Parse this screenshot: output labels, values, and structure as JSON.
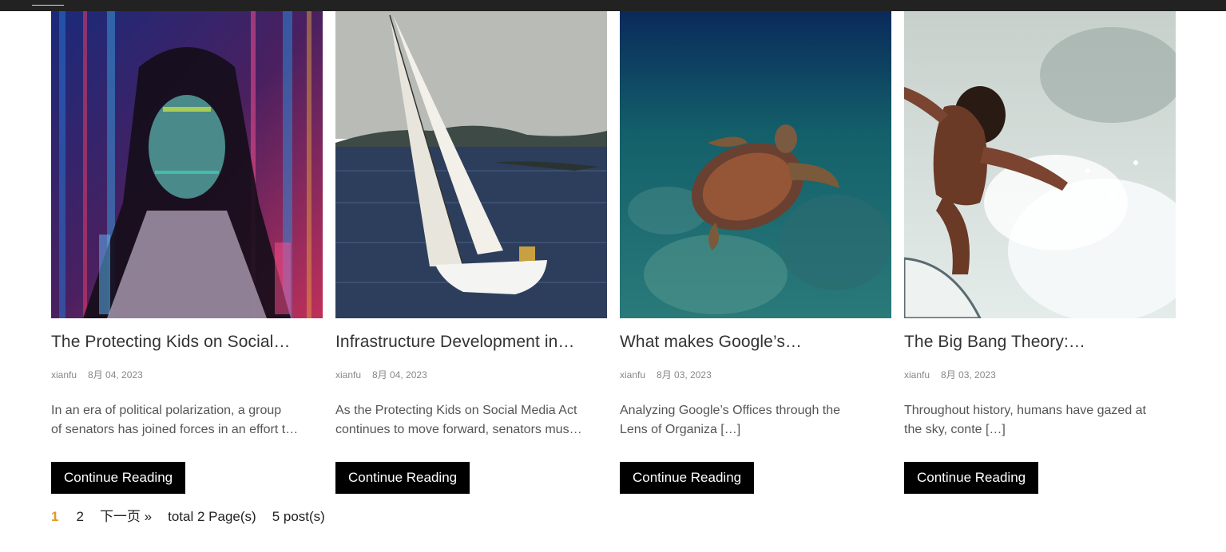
{
  "pagination": {
    "current": "1",
    "page2": "2",
    "next": "下一页 »",
    "total_pages": "total 2 Page(s)",
    "total_posts": "5 post(s)"
  },
  "posts": [
    {
      "title": "The Protecting Kids on Social…",
      "author": "xianfu",
      "date": "8月 04, 2023",
      "excerpt_line1": "In an era of political polarization, a group",
      "excerpt_line2": "of senators has joined forces in an effort t…",
      "cta": "Continue Reading",
      "image": "woman-with-code-projection-image"
    },
    {
      "title": "Infrastructure Development in…",
      "author": "xianfu",
      "date": "8月 04, 2023",
      "excerpt_line1": "As the Protecting Kids on Social Media Act",
      "excerpt_line2": "continues to move forward, senators mus…",
      "cta": "Continue Reading",
      "image": "sailboat-image"
    },
    {
      "title": "What makes Google’s…",
      "author": "xianfu",
      "date": "8月 03, 2023",
      "excerpt_line1": "Analyzing Google’s Offices through the",
      "excerpt_line2": "Lens of Organiza […]",
      "cta": "Continue Reading",
      "image": "sea-turtle-image"
    },
    {
      "title": "The Big Bang Theory:…",
      "author": "xianfu",
      "date": "8月 03, 2023",
      "excerpt_line1": "Throughout history, humans have gazed at",
      "excerpt_line2": "the sky, conte […]",
      "cta": "Continue Reading",
      "image": "surfer-image"
    }
  ]
}
